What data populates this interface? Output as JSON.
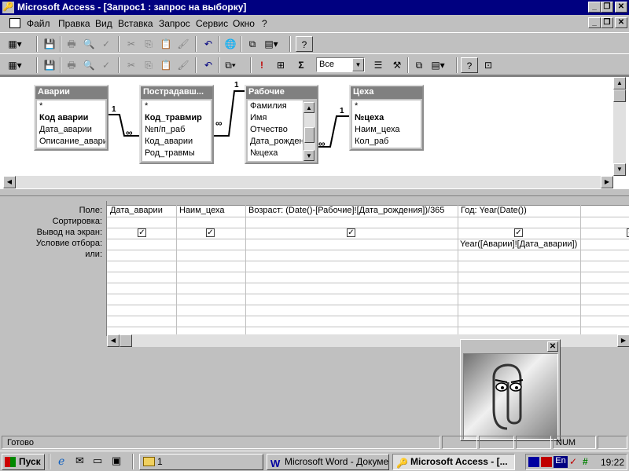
{
  "window": {
    "title": "Microsoft Access - [Запрос1 : запрос на выборку]"
  },
  "menu": [
    "Файл",
    "Правка",
    "Вид",
    "Вставка",
    "Запрос",
    "Сервис",
    "Окно",
    "?"
  ],
  "toolbar": {
    "topvalues": "Все"
  },
  "tables": [
    {
      "name": "Аварии",
      "fields": [
        "*",
        "Код аварии",
        "Дата_аварии",
        "Описание_авари"
      ],
      "bold": [
        1
      ]
    },
    {
      "name": "Пострадавш...",
      "fields": [
        "*",
        "Код_травмир",
        "№п/п_раб",
        "Код_аварии",
        "Род_травмы"
      ],
      "bold": [
        1
      ]
    },
    {
      "name": "Рабочие",
      "fields": [
        "Фамилия",
        "Имя",
        "Отчество",
        "Дата_рождени",
        "№цеха"
      ],
      "bold": []
    },
    {
      "name": "Цеха",
      "fields": [
        "*",
        "№цеха",
        "Наим_цеха",
        "Кол_раб"
      ],
      "bold": [
        1
      ]
    }
  ],
  "relations": [
    {
      "one": "1",
      "many": "∞"
    },
    {
      "one": "1",
      "many": "∞"
    },
    {
      "one": "1",
      "many": "∞"
    }
  ],
  "grid": {
    "row_labels": [
      "Поле:",
      "Сортировка:",
      "Вывод на экран:",
      "Условие отбора:",
      "или:"
    ],
    "columns": [
      {
        "field": "Дата_аварии",
        "show": true,
        "criteria": ""
      },
      {
        "field": "Наим_цеха",
        "show": true,
        "criteria": ""
      },
      {
        "field": "Возраст: (Date()-[Рабочие]![Дата_рождения])/365",
        "show": true,
        "criteria": ""
      },
      {
        "field": "Год: Year(Date())",
        "show": true,
        "criteria": "Year([Аварии]![Дата_аварии])"
      },
      {
        "field": "",
        "show": true,
        "criteria": ""
      }
    ]
  },
  "status": {
    "text": "Готово",
    "num": "NUM"
  },
  "taskbar": {
    "start": "Пуск",
    "tasks": [
      "1",
      "Microsoft Word - Докуме...",
      "Microsoft Access - [..."
    ],
    "lang": "En",
    "clock": "19:22"
  }
}
